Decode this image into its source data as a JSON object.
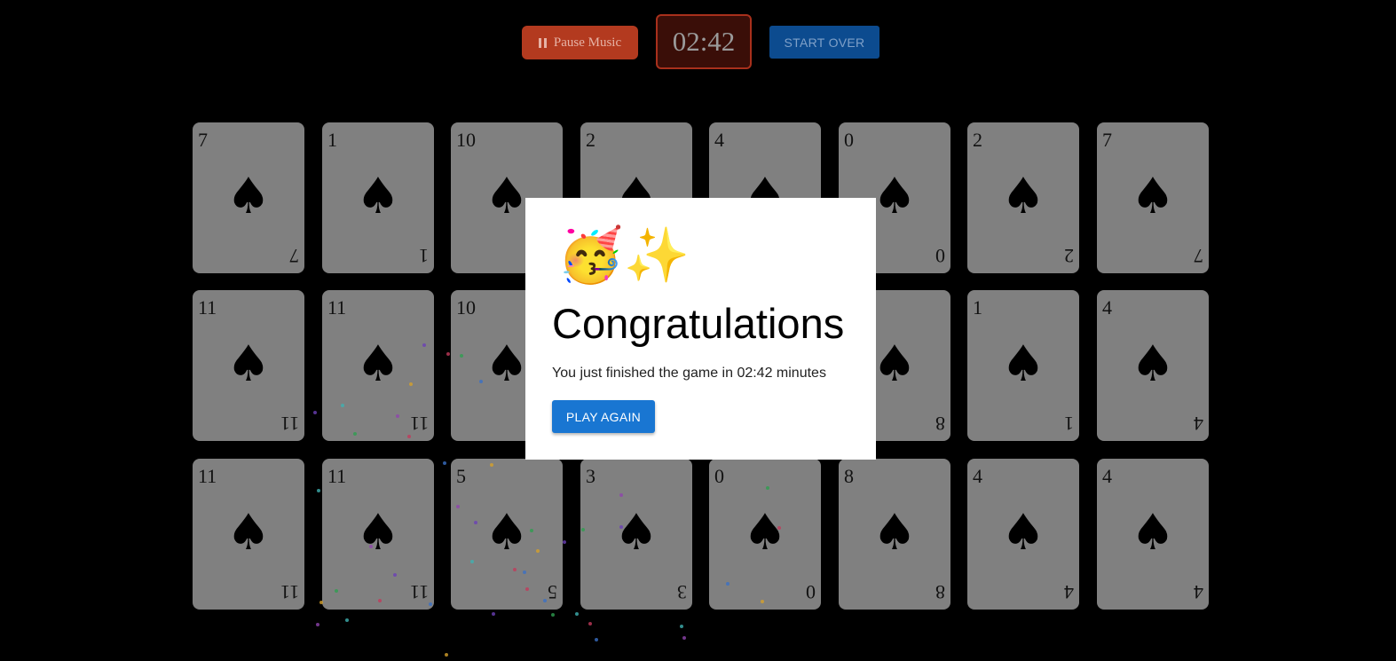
{
  "controls": {
    "music_label": "Pause Music",
    "timer": "02:42",
    "start_over_label": "START OVER"
  },
  "cards": [
    {
      "rank": "7",
      "suit": "♠"
    },
    {
      "rank": "1",
      "suit": "♠"
    },
    {
      "rank": "10",
      "suit": "♠"
    },
    {
      "rank": "2",
      "suit": "♠"
    },
    {
      "rank": "4",
      "suit": "♠"
    },
    {
      "rank": "0",
      "suit": "♠"
    },
    {
      "rank": "2",
      "suit": "♠"
    },
    {
      "rank": "7",
      "suit": "♠"
    },
    {
      "rank": "11",
      "suit": "♠"
    },
    {
      "rank": "11",
      "suit": "♠"
    },
    {
      "rank": "10",
      "suit": "♠"
    },
    {
      "rank": "",
      "suit": "♠"
    },
    {
      "rank": "",
      "suit": "♠"
    },
    {
      "rank": "8",
      "suit": "♠"
    },
    {
      "rank": "1",
      "suit": "♠"
    },
    {
      "rank": "4",
      "suit": "♠"
    },
    {
      "rank": "11",
      "suit": "♠"
    },
    {
      "rank": "11",
      "suit": "♠"
    },
    {
      "rank": "5",
      "suit": "♠"
    },
    {
      "rank": "3",
      "suit": "♠"
    },
    {
      "rank": "0",
      "suit": "♠"
    },
    {
      "rank": "8",
      "suit": "♠"
    },
    {
      "rank": "4",
      "suit": "♠"
    },
    {
      "rank": "4",
      "suit": "♠"
    }
  ],
  "modal": {
    "emoji": "🥳✨",
    "title": "Congratulations",
    "message": "You just finished the game in 02:42 minutes",
    "play_again_label": "PLAY AGAIN"
  },
  "colors": {
    "music_button": "#b33a1f",
    "timer_border": "#a8301c",
    "start_button": "#0c4b8f",
    "play_again_button": "#1976d2",
    "card_face": "#808080"
  }
}
